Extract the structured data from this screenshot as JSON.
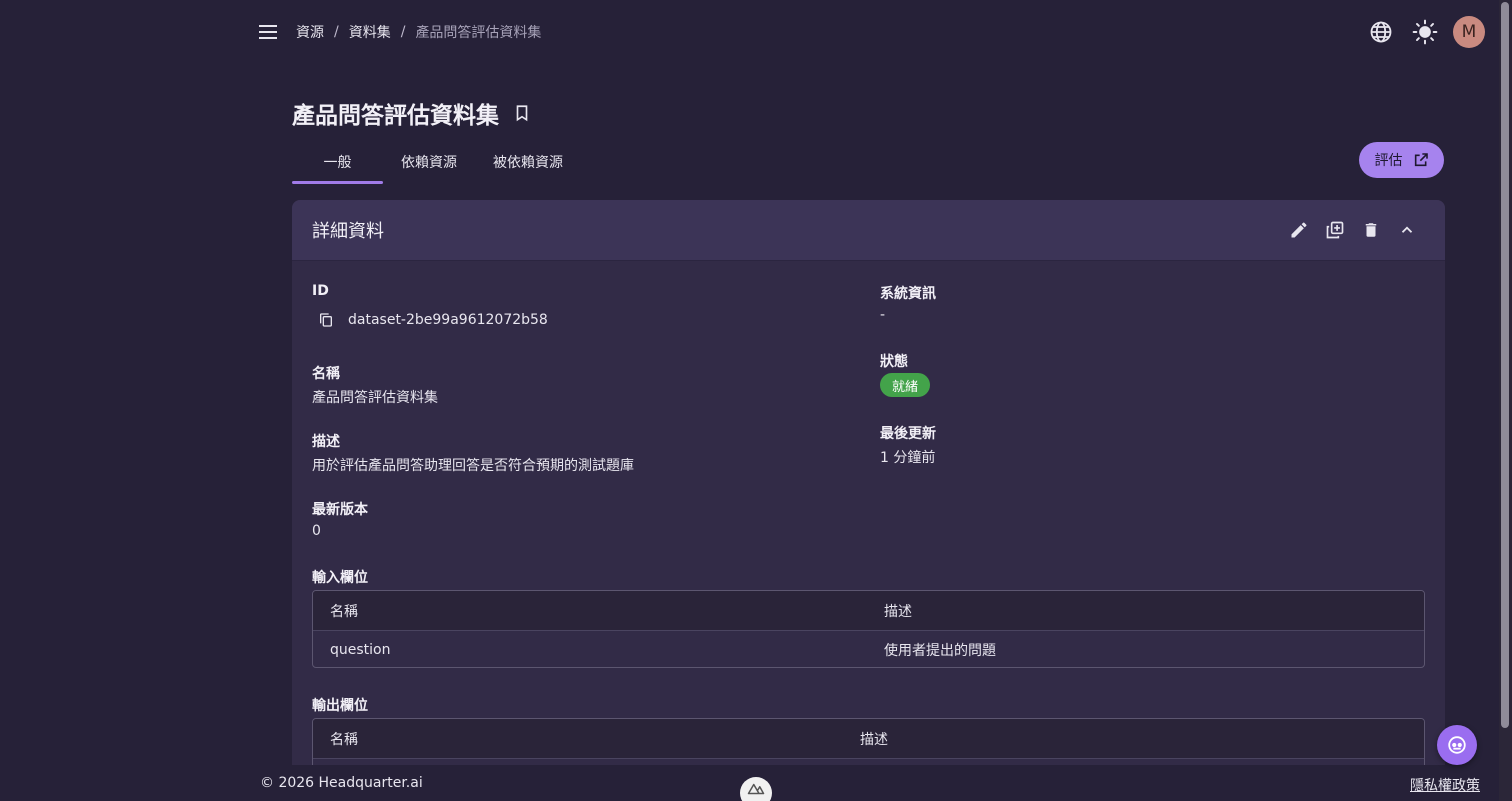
{
  "colors": {
    "background": "#262138",
    "card": "#322b47",
    "card_header": "#3c3457",
    "accent": "#a683ee",
    "status_ready": "#43a34a",
    "avatar": "#c98a80"
  },
  "header": {
    "breadcrumb": [
      "資源",
      "資料集",
      "產品問答評估資料集"
    ],
    "breadcrumb_separator": "/",
    "icons": [
      "menu-icon",
      "globe-icon",
      "sun-icon"
    ],
    "avatar_initial": "M"
  },
  "page": {
    "title": "產品問答評估資料集",
    "bookmark_icon": "bookmark-icon"
  },
  "tabs": [
    {
      "label": "一般",
      "active": true
    },
    {
      "label": "依賴資源",
      "active": false
    },
    {
      "label": "被依賴資源",
      "active": false
    }
  ],
  "evaluate_button": {
    "label": "評估",
    "icon": "open-in-new-icon"
  },
  "details": {
    "title": "詳細資料",
    "actions": [
      "edit-icon",
      "duplicate-icon",
      "delete-icon",
      "collapse-icon"
    ],
    "id_label": "ID",
    "id_value": "dataset-2be99a9612072b58",
    "system_info_label": "系統資訊",
    "system_info_value": "-",
    "name_label": "名稱",
    "name_value": "產品問答評估資料集",
    "status_label": "狀態",
    "status_value": "就緒",
    "description_label": "描述",
    "description_value": "用於評估產品問答助理回答是否符合預期的測試題庫",
    "last_updated_label": "最後更新",
    "last_updated_value": "1 分鐘前",
    "latest_version_label": "最新版本",
    "latest_version_value": "0",
    "input_fields_label": "輸入欄位",
    "input_fields": {
      "columns": [
        "名稱",
        "描述"
      ],
      "rows": [
        [
          "question",
          "使用者提出的問題"
        ]
      ]
    },
    "output_fields_label": "輸出欄位",
    "output_fields": {
      "columns": [
        "名稱",
        "描述"
      ],
      "rows": []
    }
  },
  "footer": {
    "copyright": "© 2026 Headquarter.ai",
    "privacy": "隱私權政策"
  }
}
